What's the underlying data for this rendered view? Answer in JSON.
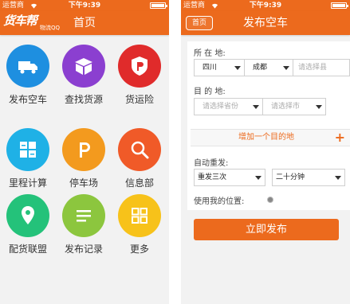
{
  "status": {
    "carrier": "运营商",
    "time": "下午9:39"
  },
  "home": {
    "logo_main": "货车帮",
    "logo_sub": "物流QQ",
    "title": "首页",
    "tiles": [
      {
        "label": "发布空车",
        "icon": "truck-icon",
        "color": "#1e8fe0"
      },
      {
        "label": "查找货源",
        "icon": "box-icon",
        "color": "#8b3fd0"
      },
      {
        "label": "货运险",
        "icon": "shield-icon",
        "color": "#e02b2b"
      },
      {
        "label": "里程计算",
        "icon": "calculator-icon",
        "color": "#1fb1e6"
      },
      {
        "label": "停车场",
        "icon": "parking-icon",
        "color": "#f39a1e"
      },
      {
        "label": "信息部",
        "icon": "search-icon",
        "color": "#f05a28"
      },
      {
        "label": "配货联盟",
        "icon": "location-pin-icon",
        "color": "#24c27a"
      },
      {
        "label": "发布记录",
        "icon": "list-icon",
        "color": "#8cc63e"
      },
      {
        "label": "更多",
        "icon": "grid-icon",
        "color": "#f7c21a"
      }
    ]
  },
  "publish": {
    "back_label": "首页",
    "title": "发布空车",
    "origin_label": "所 在 地:",
    "origin": {
      "province": "四川",
      "city": "成都",
      "county_placeholder": "请选择县"
    },
    "dest_label": "目 的 地:",
    "dest": {
      "province_placeholder": "请选择省份",
      "city_placeholder": "请选择市"
    },
    "add_dest_label": "增加一个目的地",
    "repeat_label": "自动重发:",
    "repeat_times": "重发三次",
    "repeat_interval": "二十分钟",
    "location_label": "使用我的位置:",
    "submit_label": "立即发布"
  },
  "colors": {
    "accent": "#ec6a1d"
  }
}
